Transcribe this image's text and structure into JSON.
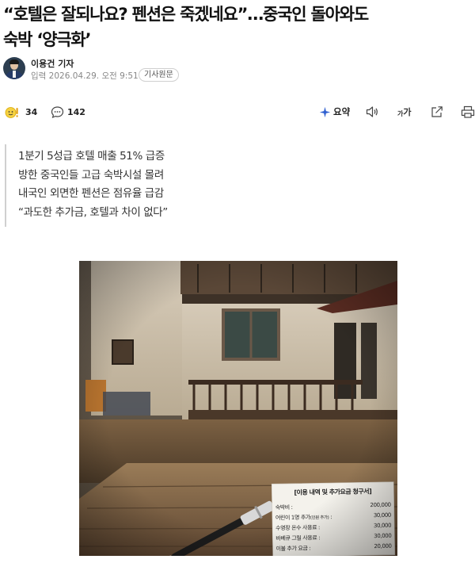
{
  "article": {
    "headline_line1": "“호텔은 잘되나요? 펜션은 죽겠네요”…중국인 돌아와도",
    "headline_line2": "숙박 ‘양극화’"
  },
  "byline": {
    "reporter": "이용건 기자",
    "input_label": "입력",
    "datetime": "2026.04.29. 오전 9:51",
    "source_button": "기사원문"
  },
  "toolbar": {
    "reaction_count": "34",
    "comment_count": "142",
    "summary_label": "요약",
    "font_size_label": "가",
    "font_size_small_label": "가"
  },
  "subheads": [
    "1분기 5성급 호텔 매출 51% 급증",
    "방한 중국인들 고급 숙박시설 몰려",
    "내국인 외면한 펜션은 점유율 급감",
    "“과도한 추가금, 호텔과 차이 없다”"
  ],
  "photo": {
    "receipt": {
      "title": "[이용 내역 및 추가요금 청구서]",
      "rows": [
        {
          "label": "숙박비 :",
          "value": "200,000"
        },
        {
          "label": "어린이 1명 추가",
          "note": "(인원 추가)",
          "colon": ":",
          "value": "30,000"
        },
        {
          "label": "수영장 온수 사용료 :",
          "value": "30,000"
        },
        {
          "label": "바베큐 그릴 사용료 :",
          "value": "30,000"
        },
        {
          "label": "이불 추가 요금 :",
          "value": "20,000"
        }
      ]
    }
  },
  "colors": {
    "summary_icon": "#2f5fd0",
    "border": "#d0d0d0",
    "muted": "#888888"
  }
}
